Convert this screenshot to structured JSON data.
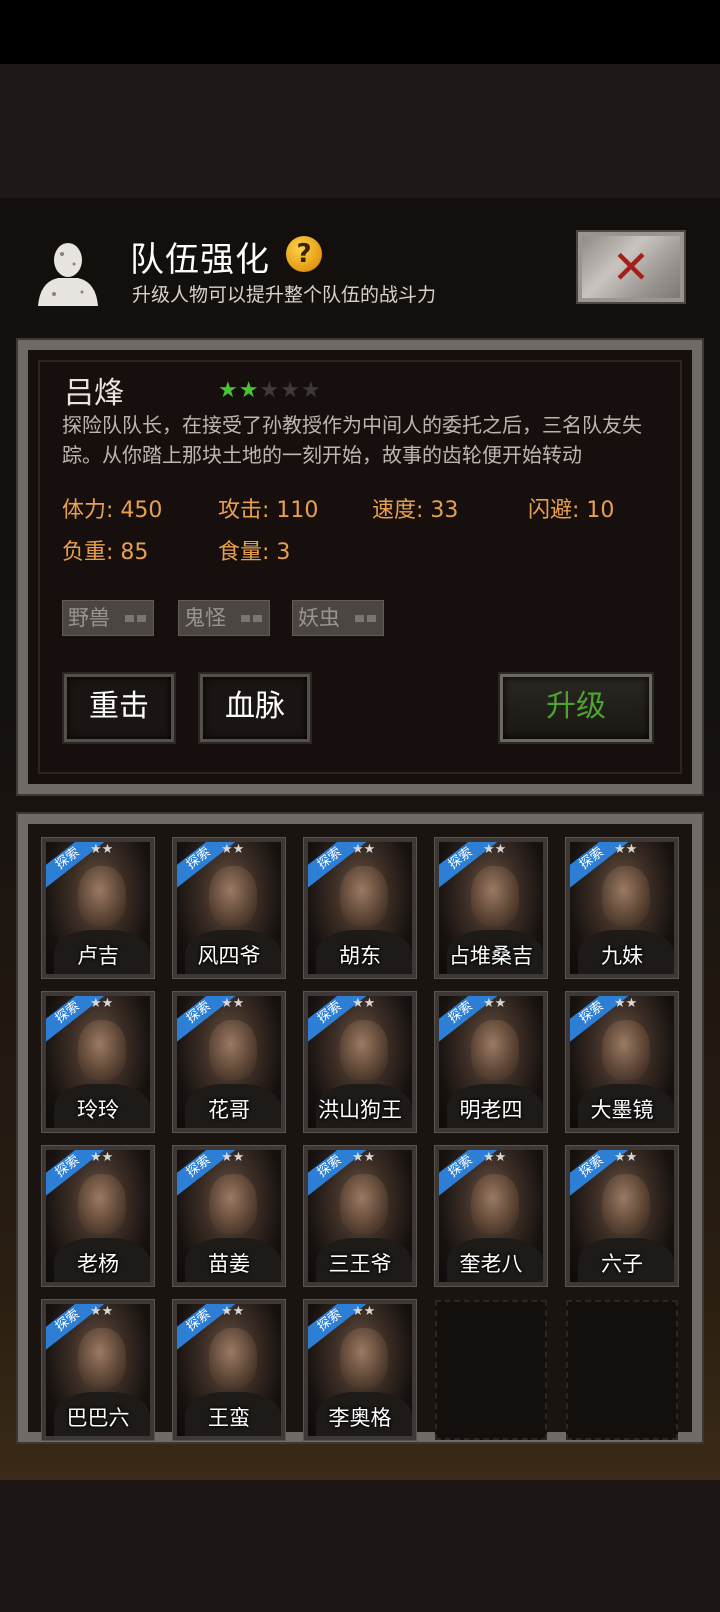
{
  "header": {
    "title": "队伍强化",
    "help_icon": "?",
    "subtitle": "升级人物可以提升整个队伍的战斗力"
  },
  "character": {
    "name": "吕烽",
    "stars_filled": 2,
    "stars_total": 5,
    "description": "探险队队长，在接受了孙教授作为中间人的委托之后，三名队友失踪。从你踏上那块土地的一刻开始，故事的齿轮便开始转动",
    "stats": [
      {
        "label": "体力: 450"
      },
      {
        "label": "攻击: 110"
      },
      {
        "label": "速度: 33"
      },
      {
        "label": "闪避: 10"
      },
      {
        "label": "负重: 85"
      },
      {
        "label": "食量: 3"
      }
    ],
    "tags": [
      "野兽",
      "鬼怪",
      "妖虫"
    ]
  },
  "buttons": {
    "heavy_strike": "重击",
    "bloodline": "血脉",
    "upgrade": "升级"
  },
  "roster": {
    "ribbon_label": "探索",
    "star_glyphs": "★★",
    "members": [
      "卢吉",
      "风四爷",
      "胡东",
      "占堆桑吉",
      "九妹",
      "玲玲",
      "花哥",
      "洪山狗王",
      "明老四",
      "大墨镜",
      "老杨",
      "苗姜",
      "三王爷",
      "奎老八",
      "六子",
      "巴巴六",
      "王蛮",
      "李奥格"
    ]
  },
  "colors": {
    "stat_text": "#e9a04e",
    "star_active": "#4ac335",
    "upgrade_text": "#4ca42f",
    "ribbon": "#2d7fd6"
  }
}
